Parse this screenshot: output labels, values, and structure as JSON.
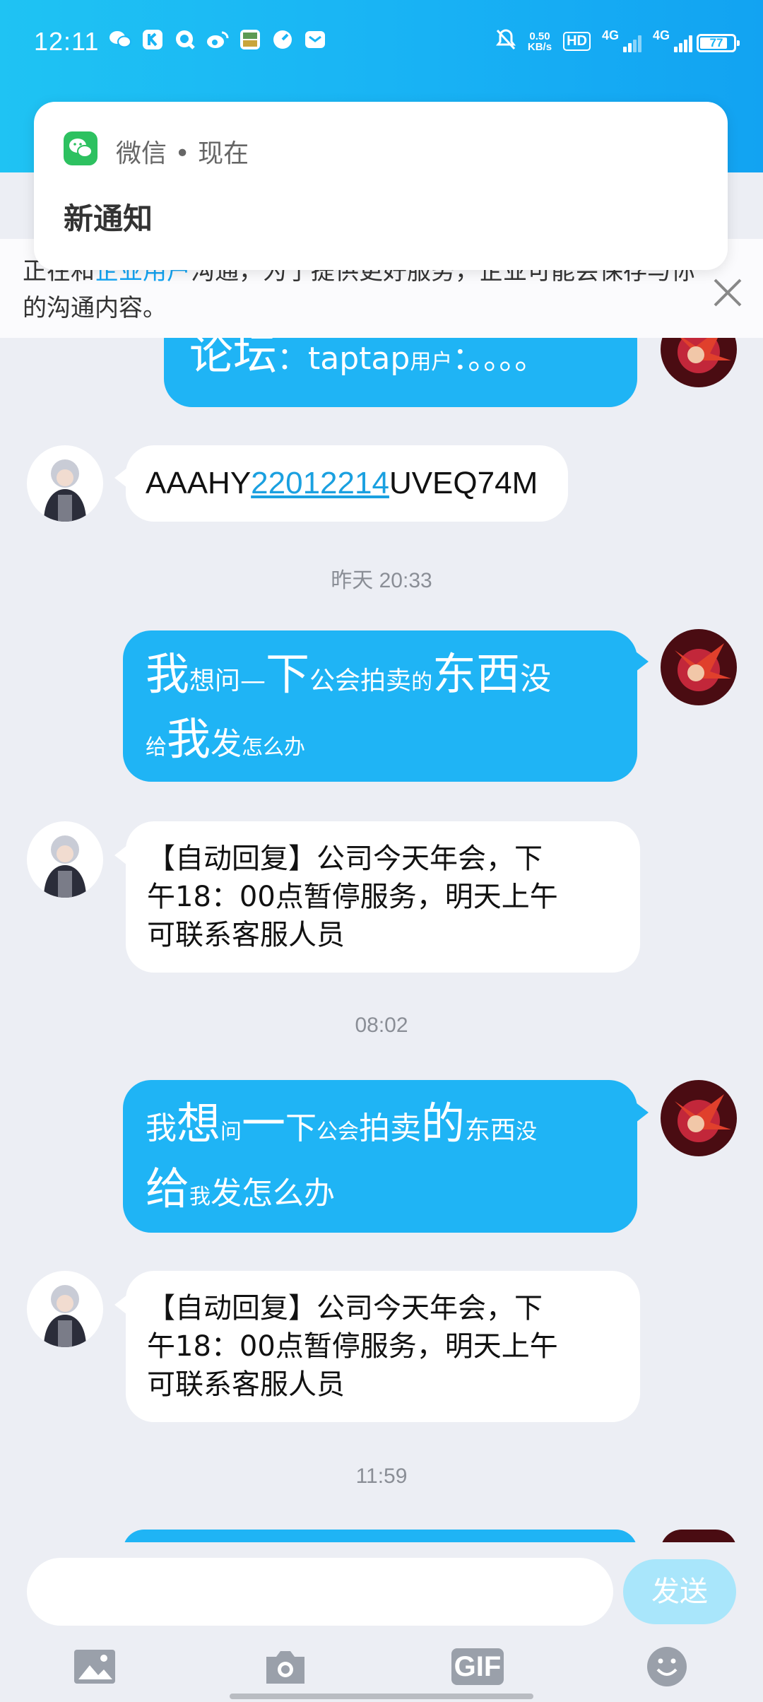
{
  "status_bar": {
    "time": "12:11",
    "net_speed_value": "0.50",
    "net_speed_unit": "KB/s",
    "hd_label": "HD",
    "sim1": "4G",
    "sim2": "4G",
    "battery": "77"
  },
  "notification": {
    "source": "微信 • 现在",
    "title": "新通知"
  },
  "notice": {
    "prefix": "正在和",
    "highlight": "企业用户",
    "suffix": "沟通，为了提供更好服务，企业可能会保存与你的沟通内容。"
  },
  "messages": {
    "m0": {
      "part1": "论坛",
      "part2": "：taptap",
      "part3": "用户",
      "part4": "：。。。。"
    },
    "m1": {
      "part1": "AAAHY",
      "link": "22012214",
      "part2": "UVEQ74M"
    },
    "t1": "昨天 20:33",
    "m2": {
      "w1": "我",
      "w2": "想问",
      "w3": "—",
      "w4": "下",
      "w5": "公会拍卖",
      "w6": "的",
      "w7": "东西",
      "w8": "没",
      "w9": "给",
      "w10": "我",
      "w11": "发",
      "w12": "怎么办"
    },
    "m3": {
      "line1": "【自动回复】公司今天年会，下",
      "line2": "午18：00点暂停服务，明天上午",
      "line3": "可联系客服人员"
    },
    "t2": "08:02",
    "m4": {
      "w1": "我",
      "w2": "想",
      "w3": "问",
      "w4": "一",
      "w5": "下",
      "w6": "公会",
      "w7": "拍卖",
      "w8": "的",
      "w9": "东西",
      "w10": "没",
      "w11": "给",
      "w12": "我",
      "w13": "发怎么办"
    },
    "m5": {
      "line1": "【自动回复】公司今天年会，下",
      "line2": "午18：00点暂停服务，明天上午",
      "line3": "可联系客服人员"
    },
    "t3": "11:59"
  },
  "composer": {
    "send_label": "发送",
    "gif_label": "GIF"
  },
  "colors": {
    "header": "#19b4f4",
    "out_bubble": "#1fb4f5",
    "in_bubble": "#ffffff",
    "background": "#eceef4",
    "wechat_green": "#2dc160",
    "send_disabled": "#a9e6fb"
  },
  "icons": [
    "wechat-icon",
    "close-icon",
    "image-icon",
    "camera-icon",
    "gif-icon",
    "emoji-icon"
  ]
}
